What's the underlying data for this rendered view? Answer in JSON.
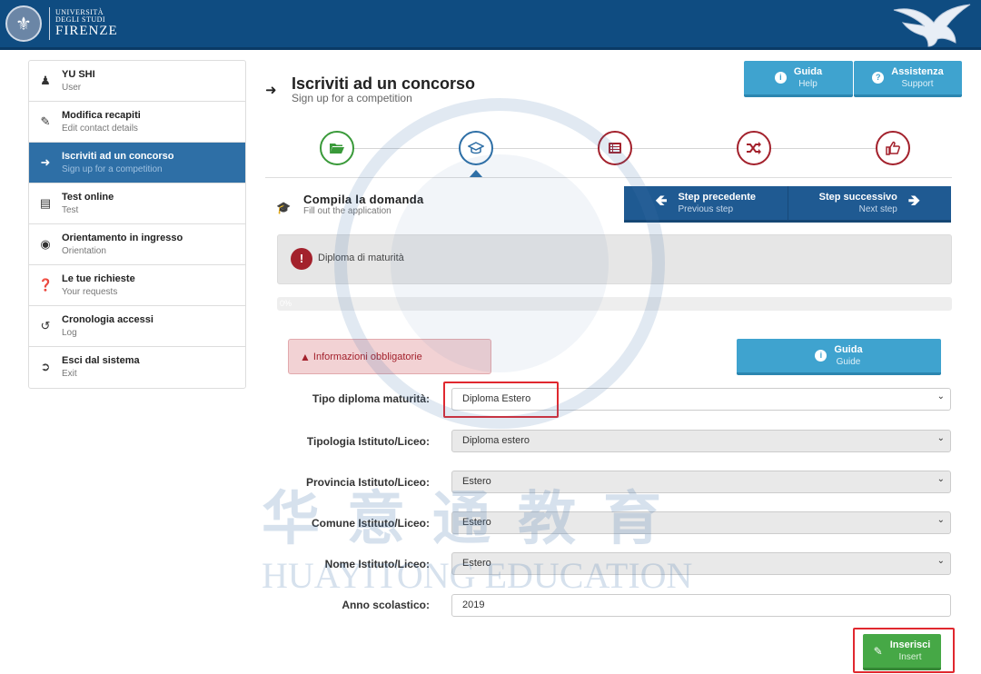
{
  "header": {
    "logo_line1": "UNIVERSITÀ",
    "logo_line2": "DEGLI STUDI",
    "logo_line3": "FIRENZE"
  },
  "sidebar": {
    "items": [
      {
        "title": "YU SHI",
        "subtitle": "User",
        "icon": "user-icon"
      },
      {
        "title": "Modifica recapiti",
        "subtitle": "Edit contact details",
        "icon": "edit-icon"
      },
      {
        "title": "Iscriviti ad un concorso",
        "subtitle": "Sign up for a competition",
        "icon": "sign-in-icon",
        "active": true
      },
      {
        "title": "Test online",
        "subtitle": "Test",
        "icon": "list-icon"
      },
      {
        "title": "Orientamento in ingresso",
        "subtitle": "Orientation",
        "icon": "compass-icon"
      },
      {
        "title": "Le tue richieste",
        "subtitle": "Your requests",
        "icon": "question-icon"
      },
      {
        "title": "Cronologia accessi",
        "subtitle": "Log",
        "icon": "history-icon"
      },
      {
        "title": "Esci dal sistema",
        "subtitle": "Exit",
        "icon": "logout-icon"
      }
    ]
  },
  "page": {
    "title": "Iscriviti ad un concorso",
    "subtitle": "Sign up for a competition"
  },
  "top_buttons": {
    "guida_label": "Guida",
    "guida_sub": "Help",
    "assistenza_label": "Assistenza",
    "assistenza_sub": "Support"
  },
  "steps": [
    {
      "icon": "folder-open-icon",
      "color": "#3a9a3a"
    },
    {
      "icon": "graduation-cap-icon",
      "color": "#2e6fa6",
      "current": true
    },
    {
      "icon": "list-icon",
      "color": "#a3212c"
    },
    {
      "icon": "shuffle-icon",
      "color": "#a3212c"
    },
    {
      "icon": "thumbs-up-icon",
      "color": "#a3212c"
    }
  ],
  "section": {
    "title": "Compila la domanda",
    "subtitle": "Fill out the application",
    "prev_label": "Step precedente",
    "prev_sub": "Previous step",
    "next_label": "Step successivo",
    "next_sub": "Next step"
  },
  "alert": {
    "text": "Diploma di maturità"
  },
  "progress": {
    "label": "0%",
    "value": 0
  },
  "required_box": {
    "text": "Informazioni obbligatorie"
  },
  "guide_button": {
    "label": "Guida",
    "sub": "Guide"
  },
  "form": {
    "tipo_diploma_label": "Tipo diploma maturità:",
    "tipo_diploma_value": "Diploma Estero",
    "tipologia_label": "Tipologia Istituto/Liceo:",
    "tipologia_value": "Diploma estero",
    "provincia_label": "Provincia Istituto/Liceo:",
    "provincia_value": "Estero",
    "comune_label": "Comune Istituto/Liceo:",
    "comune_value": "Estero",
    "nome_label": "Nome Istituto/Liceo:",
    "nome_value": "Estero",
    "anno_label": "Anno scolastico:",
    "anno_value": "2019"
  },
  "insert_button": {
    "label": "Inserisci",
    "sub": "Insert"
  },
  "watermark": {
    "text_cn": "华意通教育",
    "text_en": "HUAYITONG EDUCATION"
  },
  "colors": {
    "header_bg": "#0f4c81",
    "active_nav": "#2e6fa6",
    "info_button": "#3fa3cf",
    "nav_button": "#1f5a92",
    "danger": "#a3212c",
    "success": "#46a846",
    "highlight": "#e0282f"
  }
}
